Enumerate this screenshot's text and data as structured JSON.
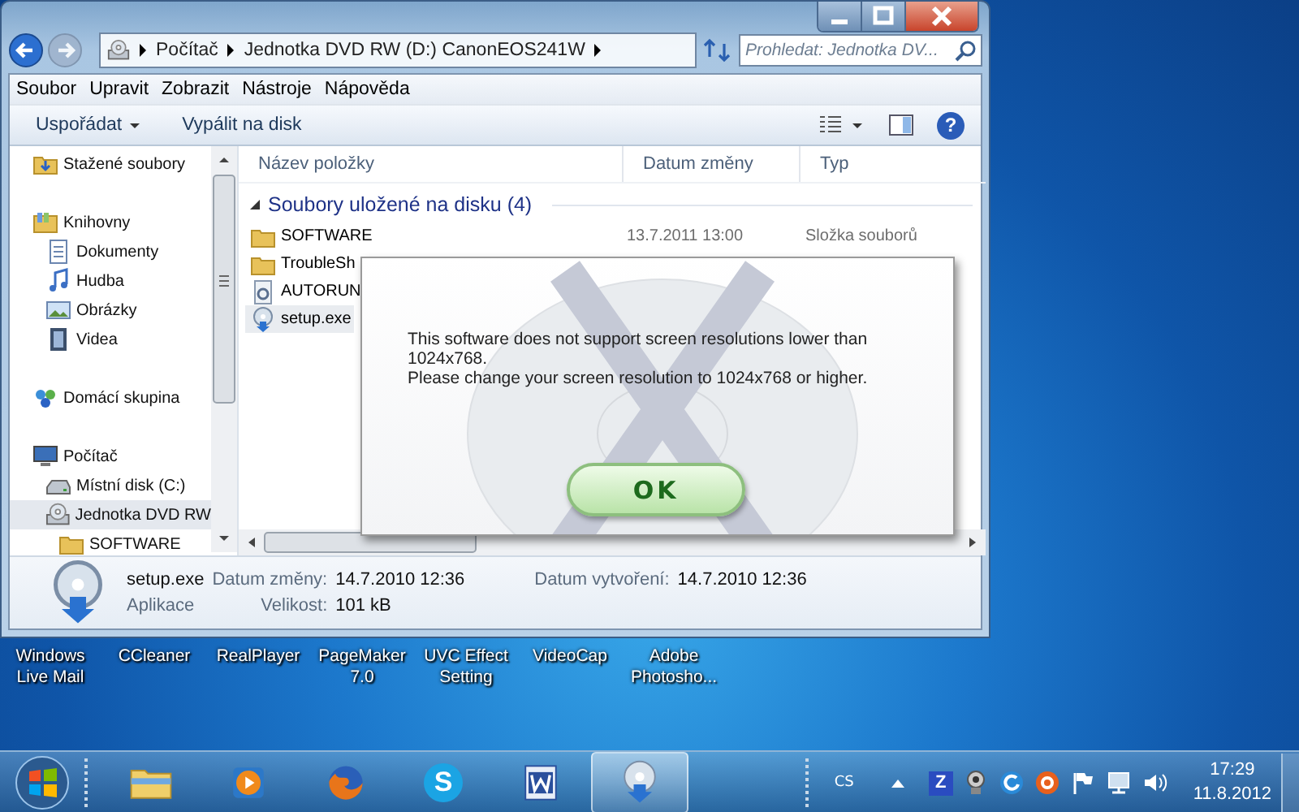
{
  "address_bar": {
    "crumbs": [
      "Počítač",
      "Jednotka DVD RW (D:) CanonEOS241W"
    ]
  },
  "search": {
    "placeholder": "Prohledat: Jednotka DV..."
  },
  "menu": [
    "Soubor",
    "Upravit",
    "Zobrazit",
    "Nástroje",
    "Nápověda"
  ],
  "toolbar": [
    {
      "label": "Uspořádat",
      "dropdown": true
    },
    {
      "label": "Vypálit na disk",
      "dropdown": false
    }
  ],
  "help": {
    "glyph": "?"
  },
  "nav": [
    {
      "label": "Stažené soubory",
      "kind": "download",
      "selected": false
    },
    {
      "label": "Knihovny",
      "kind": "library",
      "selected": false,
      "children": [
        {
          "label": "Dokumenty",
          "kind": "documents",
          "selected": false
        },
        {
          "label": "Hudba",
          "kind": "music",
          "selected": false
        },
        {
          "label": "Obrázky",
          "kind": "pictures",
          "selected": false
        },
        {
          "label": "Videa",
          "kind": "video",
          "selected": false
        }
      ]
    },
    {
      "label": "Domácí skupina",
      "kind": "homegroup",
      "selected": false
    },
    {
      "label": "Počítač",
      "kind": "computer",
      "selected": false,
      "children": [
        {
          "label": "Místní disk (C:)",
          "kind": "disk",
          "selected": false
        },
        {
          "label": "Jednotka DVD RW",
          "kind": "dvd",
          "selected": true,
          "children": [
            {
              "label": "SOFTWARE",
              "kind": "folder",
              "selected": false
            }
          ]
        }
      ]
    }
  ],
  "columns": [
    "Název položky",
    "Datum změny",
    "Typ"
  ],
  "group": {
    "title": "Soubory uložené na disku (4)"
  },
  "files": [
    {
      "name": "SOFTWARE",
      "date": "13.7.2011 13:00",
      "type": "Složka souborů",
      "kind": "folder",
      "selected": false
    },
    {
      "name": "TroubleSh",
      "kind": "folder",
      "selected": false
    },
    {
      "name": "AUTORUN",
      "kind": "settings",
      "selected": false
    },
    {
      "name": "setup.exe",
      "kind": "setup",
      "selected": true
    }
  ],
  "details": {
    "name": "setup.exe",
    "type": "Aplikace",
    "fields": [
      {
        "label": "Datum změny:",
        "value": "14.7.2010 12:36"
      },
      {
        "label": "Datum vytvoření:",
        "value": "14.7.2010 12:36"
      },
      {
        "label": "Velikost:",
        "value": "101 kB"
      }
    ]
  },
  "dialog": {
    "lines": [
      "This software does not support screen resolutions lower than 1024x768.",
      "Please change your screen resolution to 1024x768 or higher."
    ],
    "button": "OK"
  },
  "desktop_icons": [
    "Windows Live Mail",
    "CCleaner",
    "RealPlayer",
    "PageMaker 7.0",
    "UVC Effect Setting",
    "VideoCap",
    "Adobe Photosho..."
  ],
  "taskbar": {
    "apps": [
      {
        "kind": "explorer",
        "active": false
      },
      {
        "kind": "media",
        "active": false
      },
      {
        "kind": "firefox",
        "active": false
      },
      {
        "kind": "skype",
        "active": false,
        "glyph": "S"
      },
      {
        "kind": "word",
        "active": false
      },
      {
        "kind": "setup",
        "active": true
      }
    ],
    "tray": [
      {
        "kind": "zletter",
        "glyph": "Z"
      },
      {
        "kind": "webcam"
      },
      {
        "kind": "refresh"
      },
      {
        "kind": "ring"
      },
      {
        "kind": "flag"
      },
      {
        "kind": "network"
      },
      {
        "kind": "speaker"
      }
    ],
    "language": "CS",
    "time": "17:29",
    "date": "11.8.2012"
  }
}
